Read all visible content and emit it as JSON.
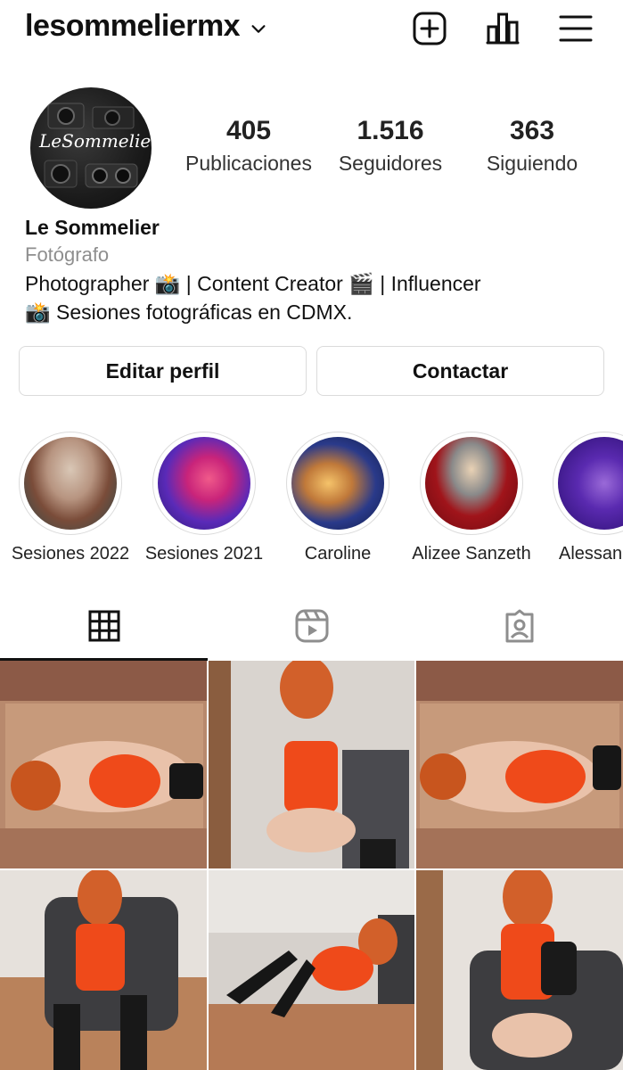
{
  "header": {
    "username": "lesommeliermx",
    "icons": [
      "chevron-down-icon",
      "new-post-icon",
      "insights-icon",
      "menu-icon"
    ]
  },
  "profile": {
    "avatar_text": "LeSommelier",
    "stats": [
      {
        "value": "405",
        "label": "Publicaciones"
      },
      {
        "value": "1.516",
        "label": "Seguidores"
      },
      {
        "value": "363",
        "label": "Siguiendo"
      }
    ],
    "name": "Le Sommelier",
    "category": "Fotógrafo",
    "bio_line1": "Photographer 📸 | Content Creator 🎬 | Influencer",
    "bio_line2": "📸 Sesiones fotográficas en CDMX."
  },
  "actions": {
    "edit": "Editar perfil",
    "contact": "Contactar"
  },
  "highlights": [
    {
      "label": "Sesiones 2022"
    },
    {
      "label": "Sesiones 2021"
    },
    {
      "label": "Caroline"
    },
    {
      "label": "Alizee Sanzeth"
    },
    {
      "label": "Alessan"
    }
  ],
  "tabs": [
    {
      "icon": "grid-icon",
      "active": true
    },
    {
      "icon": "reels-icon",
      "active": false
    },
    {
      "icon": "tagged-icon",
      "active": false
    }
  ],
  "colors": {
    "border": "#dbdbdb",
    "secondary_text": "#8e8e8e",
    "accent_orange": "#e8502a"
  }
}
